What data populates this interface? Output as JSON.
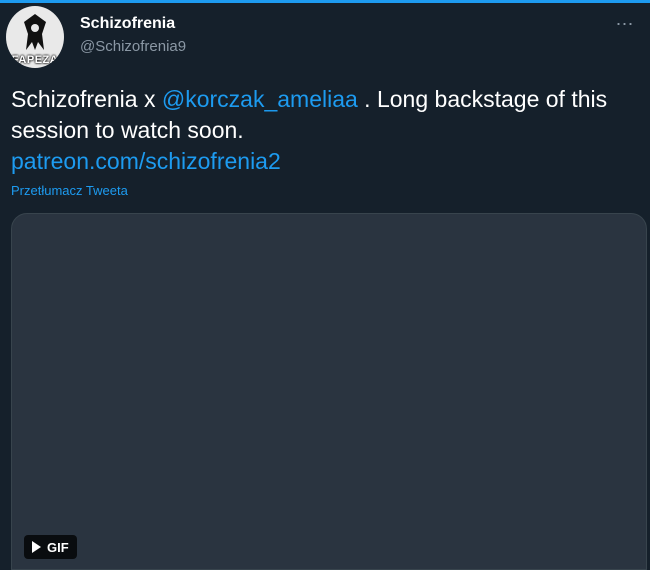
{
  "author": {
    "display_name": "Schizofrenia",
    "handle": "@Schizofrenia9",
    "avatar_watermark": "FAPEZA"
  },
  "tweet": {
    "text_before": "Schizofrenia x ",
    "mention": "@korczak_ameliaa",
    "text_after": " . Long backstage of this session to watch soon.",
    "link": "patreon.com/schizofrenia2",
    "translate_label": "Przetłumacz Tweeta"
  },
  "media": {
    "badge_label": "GIF"
  },
  "icons": {
    "more": "more-icon",
    "play": "play-icon"
  },
  "colors": {
    "background": "#15202b",
    "accent": "#1d9bf0",
    "secondary_text": "#8b98a5"
  }
}
